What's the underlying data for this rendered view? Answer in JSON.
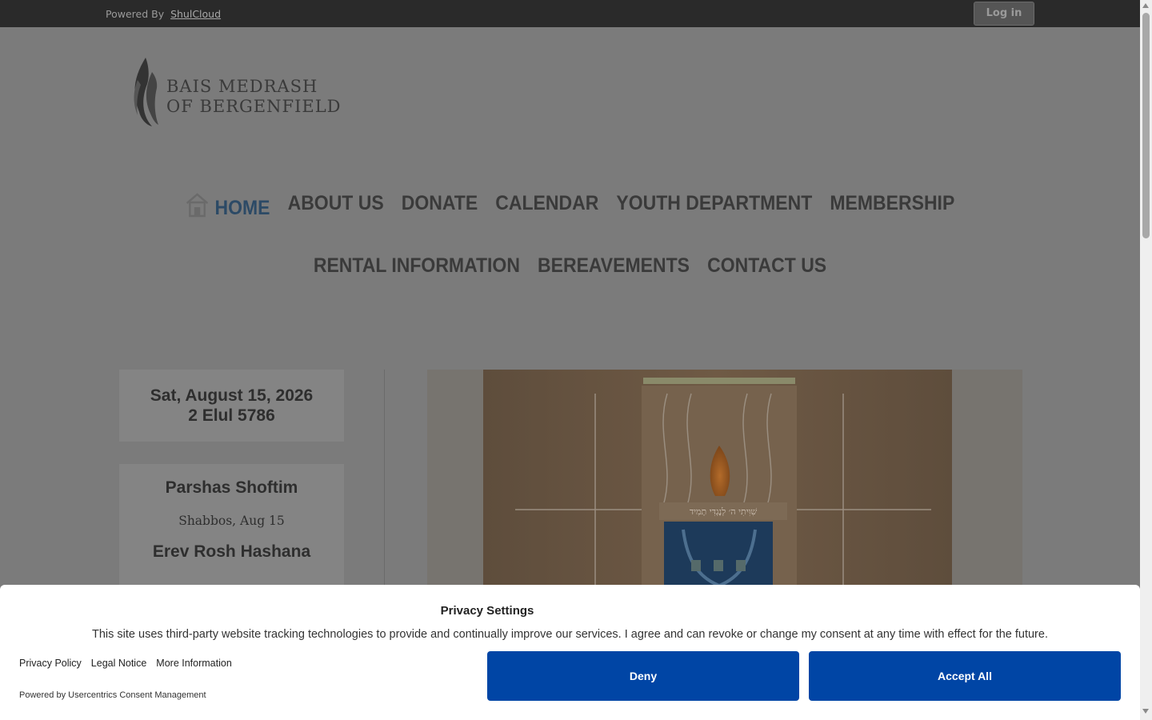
{
  "topbar": {
    "powered_by_label": "Powered By",
    "powered_by_link": "ShulCloud",
    "login_label": "Log in"
  },
  "logo": {
    "line1": "BAIS MEDRASH",
    "line2": "OF BERGENFIELD"
  },
  "nav": {
    "row1": [
      {
        "label": "HOME",
        "active": true
      },
      {
        "label": "ABOUT US"
      },
      {
        "label": "DONATE"
      },
      {
        "label": "CALENDAR"
      },
      {
        "label": "YOUTH DEPARTMENT"
      },
      {
        "label": "MEMBERSHIP"
      }
    ],
    "row2": [
      {
        "label": "RENTAL INFORMATION"
      },
      {
        "label": "BEREAVEMENTS"
      },
      {
        "label": "CONTACT US"
      }
    ]
  },
  "date": {
    "gregorian": "Sat, August 15, 2026",
    "hebrew": "2 Elul 5786"
  },
  "parsha": {
    "title": "Parshas Shoftim",
    "subtitle": "Shabbos, Aug 15",
    "next": "Erev Rosh Hashana"
  },
  "hero": {
    "inscription": "שִׁוִּיתִי ה׳ לְנֶגְדִּי תָמִיד"
  },
  "consent": {
    "title": "Privacy Settings",
    "description": "This site uses third-party website tracking technologies to provide and continually improve our services. I agree and can revoke or change my consent at any time with effect for the future.",
    "links": [
      "Privacy Policy",
      "Legal Notice",
      "More Information"
    ],
    "powered": "Powered by Usercentrics Consent Management",
    "deny_label": "Deny",
    "accept_label": "Accept All"
  },
  "colors": {
    "accent_button": "#0045a5",
    "nav_active": "#2c4a66",
    "topbar": "#2a2a2a"
  }
}
